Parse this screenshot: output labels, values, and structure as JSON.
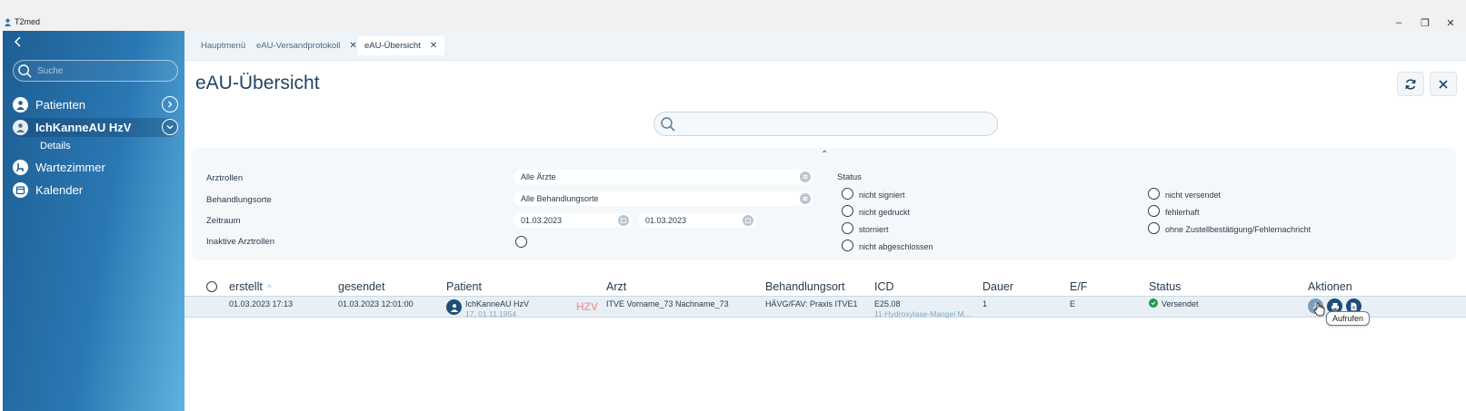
{
  "window": {
    "title": "T2med",
    "controls": {
      "minimize": "–",
      "restore": "❐",
      "close": "✕"
    }
  },
  "sidebar": {
    "search_placeholder": "Suche",
    "items": [
      {
        "label": "Patienten",
        "icon": "person-icon"
      },
      {
        "label": "IchKanneAU HzV",
        "icon": "patient-avatar-icon",
        "active": true
      },
      {
        "label": "Details",
        "sub": true
      },
      {
        "label": "Wartezimmer",
        "icon": "waiting-room-icon"
      },
      {
        "label": "Kalender",
        "icon": "calendar-icon"
      }
    ]
  },
  "tabs": [
    {
      "label": "Hauptmenü",
      "closable": false
    },
    {
      "label": "eAU-Versandprotokoll",
      "closable": true
    },
    {
      "label": "eAU-Übersicht",
      "closable": true,
      "active": true
    }
  ],
  "page": {
    "title": "eAU-Übersicht",
    "search_value": ""
  },
  "filters": {
    "arztrollen_label": "Arztrollen",
    "arztrollen_value": "Alle Ärzte",
    "behandlungsorte_label": "Behandlungsorte",
    "behandlungsorte_value": "Alle Behandlungsorte",
    "zeitraum_label": "Zeitraum",
    "zeitraum_from": "01.03.2023",
    "zeitraum_to": "01.03.2023",
    "inaktive_label": "Inaktive Arztrollen",
    "status_label": "Status",
    "status_options": [
      "nicht signiert",
      "nicht gedruckt",
      "storniert",
      "nicht abgeschlossen",
      "nicht versendet",
      "fehlerhaft",
      "ohne Zustellbestätigung/Fehlernachricht"
    ]
  },
  "table": {
    "headers": {
      "erstellt": "erstellt",
      "sort_indicator": "^",
      "gesendet": "gesendet",
      "patient": "Patient",
      "arzt": "Arzt",
      "behandlungsort": "Behandlungsort",
      "icd": "ICD",
      "dauer": "Dauer",
      "ef": "E/F",
      "status": "Status",
      "aktionen": "Aktionen"
    },
    "rows": [
      {
        "erstellt": "01.03.2023 17:13",
        "gesendet": "01.03.2023 12:01:00",
        "patient_name": "IchKanneAU HzV",
        "patient_sub": "17, 01.11.1954",
        "badge": "HZV",
        "arzt": "ITVE Vorname_73 Nachname_73",
        "behandlungsort": "HÄVG/FAV: Praxis ITVE1",
        "icd": "E25.08",
        "icd_sub": "11-Hydroxylase-Mangel M...",
        "dauer": "1",
        "ef": "E",
        "status": "Versendet"
      }
    ]
  },
  "tooltip": "Aufrufen",
  "colors": {
    "sidebar_dark": "#1e5e94",
    "sidebar_light": "#5fb3df",
    "accent_navy": "#1f4c78",
    "status_green": "#1f9a4b",
    "hzv_red": "#f0a3a3"
  }
}
